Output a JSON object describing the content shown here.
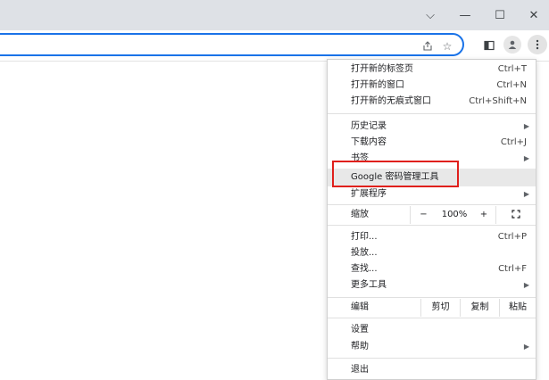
{
  "window_controls": {
    "dropdown": "⌵",
    "minimize": "—",
    "maximize": "☐",
    "close": "✕"
  },
  "toolbar": {
    "share_icon": "share-icon",
    "bookmark_icon": "bookmark-star-icon",
    "side_panel_icon": "side-panel-icon",
    "profile_icon": "profile-icon",
    "menu_icon": "kebab-menu-icon"
  },
  "menu": {
    "new_tab": {
      "label": "打开新的标签页",
      "shortcut": "Ctrl+T"
    },
    "new_window": {
      "label": "打开新的窗口",
      "shortcut": "Ctrl+N"
    },
    "incognito": {
      "label": "打开新的无痕式窗口",
      "shortcut": "Ctrl+Shift+N"
    },
    "history": {
      "label": "历史记录"
    },
    "downloads": {
      "label": "下载内容",
      "shortcut": "Ctrl+J"
    },
    "bookmarks": {
      "label": "书签"
    },
    "password_manager": {
      "label": "Google 密码管理工具"
    },
    "extensions": {
      "label": "扩展程序"
    },
    "zoom": {
      "label": "缩放",
      "minus": "−",
      "value": "100%",
      "plus": "+",
      "fullscreen": "⛶"
    },
    "print": {
      "label": "打印...",
      "shortcut": "Ctrl+P"
    },
    "cast": {
      "label": "投放..."
    },
    "find": {
      "label": "查找...",
      "shortcut": "Ctrl+F"
    },
    "more_tools": {
      "label": "更多工具"
    },
    "edit": {
      "label": "编辑",
      "cut": "剪切",
      "copy": "复制",
      "paste": "粘贴"
    },
    "settings": {
      "label": "设置"
    },
    "help": {
      "label": "帮助"
    },
    "exit": {
      "label": "退出"
    }
  },
  "colors": {
    "highlight_box": "#e0201c",
    "omnibox_border": "#1a73e8",
    "hover_bg": "#e8e8e8"
  }
}
